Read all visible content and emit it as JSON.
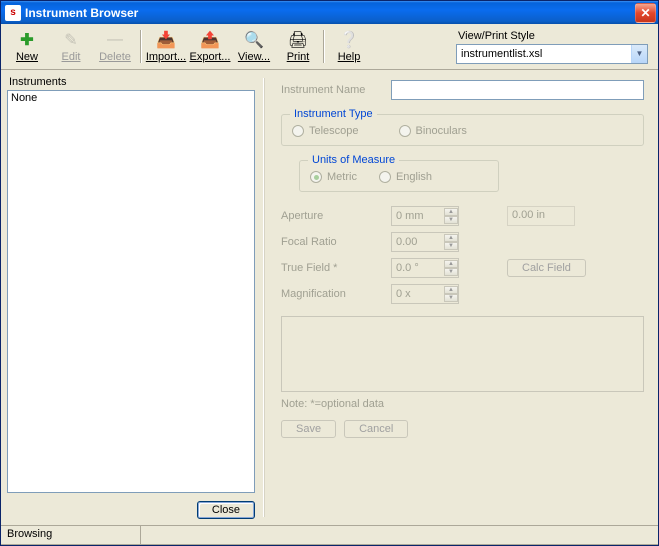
{
  "window": {
    "title": "Instrument Browser"
  },
  "toolbar": {
    "new": "New",
    "edit": "Edit",
    "delete": "Delete",
    "import": "Import...",
    "export": "Export...",
    "view": "View...",
    "print": "Print",
    "help": "Help"
  },
  "style": {
    "label": "View/Print Style",
    "selected": "instrumentlist.xsl"
  },
  "left": {
    "label": "Instruments",
    "items": [
      "None"
    ],
    "close": "Close"
  },
  "form": {
    "name_label": "Instrument Name",
    "name_value": "",
    "type": {
      "legend": "Instrument Type",
      "telescope": "Telescope",
      "binoculars": "Binoculars",
      "selected": "Telescope"
    },
    "units": {
      "legend": "Units of Measure",
      "metric": "Metric",
      "english": "English",
      "selected": "Metric"
    },
    "aperture": {
      "label": "Aperture",
      "mm": "0 mm",
      "in": "0.00 in"
    },
    "focal": {
      "label": "Focal Ratio",
      "value": "0.00"
    },
    "truefield": {
      "label": "True Field *",
      "value": "0.0 °"
    },
    "calc": "Calc Field",
    "mag": {
      "label": "Magnification",
      "value": "0 x"
    },
    "note": "Note: *=optional data",
    "save": "Save",
    "cancel": "Cancel"
  },
  "status": {
    "text": "Browsing"
  }
}
